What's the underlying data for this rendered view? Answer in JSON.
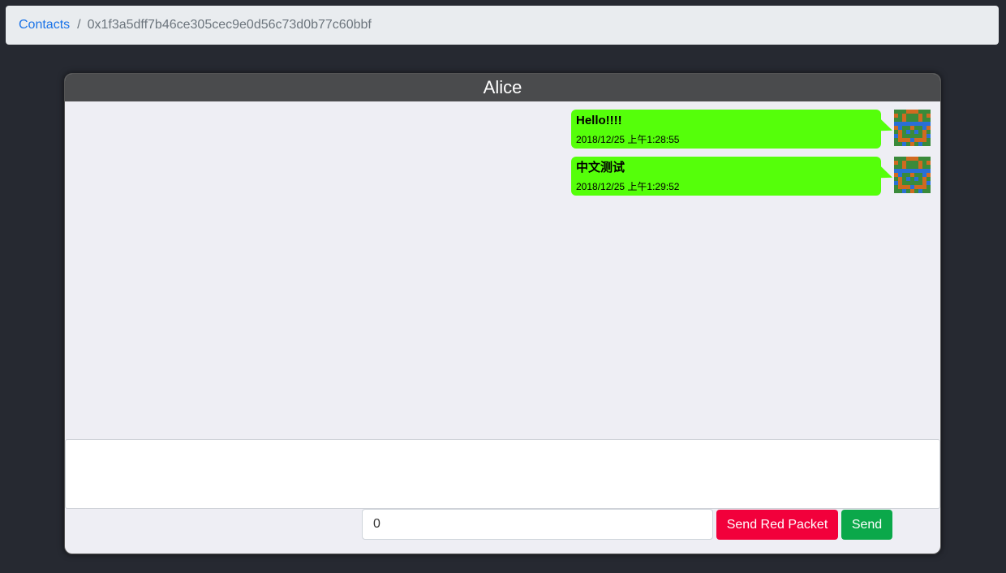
{
  "breadcrumb": {
    "contacts_label": "Contacts",
    "separator": "/",
    "current": "0x1f3a5dff7b46ce305cec9e0d56c73d0b77c60bbf"
  },
  "chat": {
    "title": "Alice",
    "messages": [
      {
        "text": "Hello!!!!",
        "time": "2018/12/25 上午1:28:55"
      },
      {
        "text": "中文测试",
        "time": "2018/12/25 上午1:29:52"
      }
    ]
  },
  "composer": {
    "message_value": "",
    "amount_value": "0",
    "send_red_packet_label": "Send Red Packet",
    "send_label": "Send"
  },
  "colors": {
    "bubble": "#55ff0a",
    "red_button": "#f2003b",
    "green_button": "#0ba84a",
    "header": "#4a4b4d",
    "avatar_palette": [
      "#3a8a3a",
      "#d06a20",
      "#2a6fd6"
    ]
  }
}
